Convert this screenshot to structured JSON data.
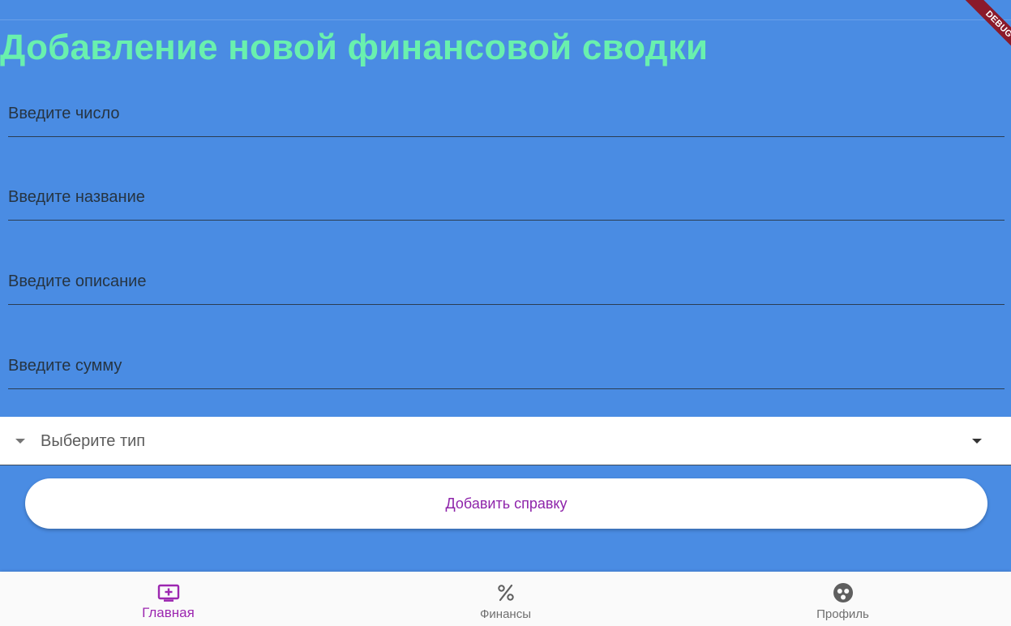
{
  "page": {
    "title": "Добавление новой финансовой сводки"
  },
  "form": {
    "fields": [
      {
        "placeholder": "Введите число",
        "value": ""
      },
      {
        "placeholder": "Введите название",
        "value": ""
      },
      {
        "placeholder": "Введите описание",
        "value": ""
      },
      {
        "placeholder": "Введите сумму",
        "value": ""
      }
    ],
    "type_dropdown": {
      "label": "Выберите тип",
      "icon": "arrow-drop-down-icon"
    },
    "submit_label": "Добавить справку"
  },
  "bottom_nav": {
    "items": [
      {
        "label": "Главная",
        "icon": "add-to-queue-icon",
        "active": true
      },
      {
        "label": "Финансы",
        "icon": "percent-icon",
        "active": false
      },
      {
        "label": "Профиль",
        "icon": "face-icon",
        "active": false
      }
    ]
  },
  "debug_banner": {
    "label": "DEBUG"
  },
  "colors": {
    "background": "#4a8ce3",
    "title": "#69f0ae",
    "accent": "#9c27b0",
    "debug": "#8b1a2b"
  }
}
